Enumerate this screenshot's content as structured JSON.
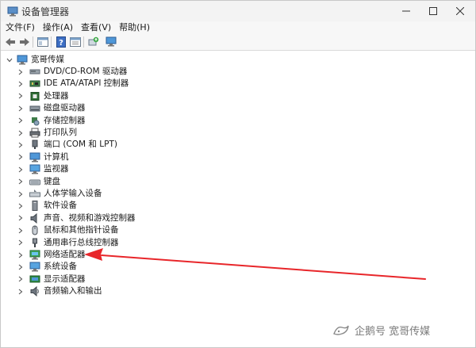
{
  "window": {
    "title": "设备管理器",
    "app_icon": "device-manager-icon"
  },
  "menu": {
    "items": [
      {
        "label": "文件(F)"
      },
      {
        "label": "操作(A)"
      },
      {
        "label": "查看(V)"
      },
      {
        "label": "帮助(H)"
      }
    ]
  },
  "toolbar": {
    "buttons": [
      "back-icon",
      "forward-icon",
      "show-hide-console-tree-icon",
      "help-icon",
      "properties-icon",
      "update-driver-icon",
      "scan-hardware-icon"
    ]
  },
  "tree": {
    "root_label": "宽哥传媒",
    "items": [
      {
        "label": "DVD/CD-ROM 驱动器",
        "icon": "dvd-drive-icon"
      },
      {
        "label": "IDE ATA/ATAPI 控制器",
        "icon": "ide-controller-icon"
      },
      {
        "label": "处理器",
        "icon": "processor-icon"
      },
      {
        "label": "磁盘驱动器",
        "icon": "disk-drive-icon"
      },
      {
        "label": "存储控制器",
        "icon": "storage-controller-icon"
      },
      {
        "label": "打印队列",
        "icon": "printer-icon"
      },
      {
        "label": "端口 (COM 和 LPT)",
        "icon": "port-icon"
      },
      {
        "label": "计算机",
        "icon": "computer-icon"
      },
      {
        "label": "监视器",
        "icon": "monitor-icon"
      },
      {
        "label": "键盘",
        "icon": "keyboard-icon"
      },
      {
        "label": "人体学输入设备",
        "icon": "hid-icon"
      },
      {
        "label": "软件设备",
        "icon": "software-device-icon"
      },
      {
        "label": "声音、视频和游戏控制器",
        "icon": "sound-icon"
      },
      {
        "label": "鼠标和其他指针设备",
        "icon": "mouse-icon"
      },
      {
        "label": "通用串行总线控制器",
        "icon": "usb-icon"
      },
      {
        "label": "网络适配器",
        "icon": "network-adapter-icon"
      },
      {
        "label": "系统设备",
        "icon": "system-device-icon"
      },
      {
        "label": "显示适配器",
        "icon": "display-adapter-icon"
      },
      {
        "label": "音频输入和输出",
        "icon": "audio-io-icon"
      }
    ]
  },
  "watermark": {
    "text": "企鹅号 宽哥传媒"
  },
  "colors": {
    "annotation_arrow": "#e8262a",
    "titlebar_bg": "#f3f3f3"
  }
}
